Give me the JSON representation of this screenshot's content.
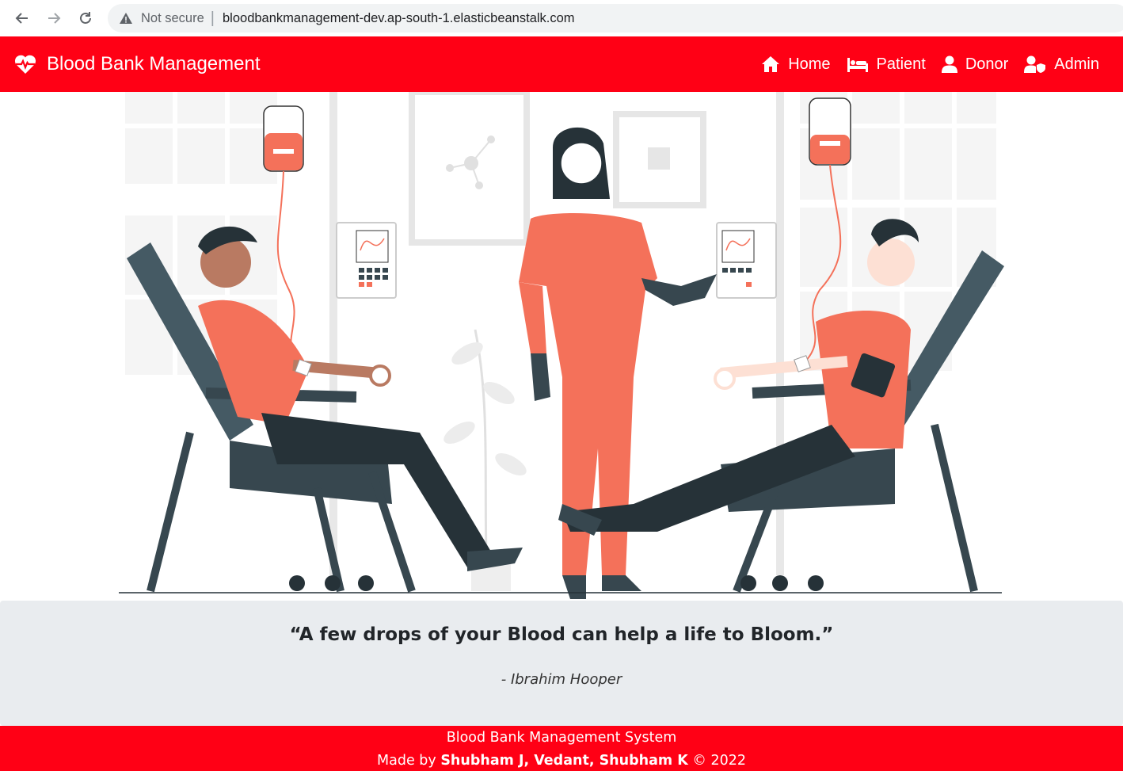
{
  "browser": {
    "security_label": "Not secure",
    "url": "bloodbankmanagement-dev.ap-south-1.elasticbeanstalk.com"
  },
  "navbar": {
    "brand": "Blood Bank Management",
    "items": [
      {
        "label": "Home",
        "icon": "home-icon"
      },
      {
        "label": "Patient",
        "icon": "bed-icon"
      },
      {
        "label": "Donor",
        "icon": "user-icon"
      },
      {
        "label": "Admin",
        "icon": "user-shield-icon"
      }
    ]
  },
  "hero": {
    "illustration": "blood-donation-illustration"
  },
  "quote": {
    "text": "“A few drops of your Blood can help a life to Bloom.”",
    "author": "- Ibrahim Hooper"
  },
  "footer": {
    "line1": "Blood Bank Management System",
    "made_by_prefix": "Made by",
    "authors": "Shubham J, Vedant, Shubham K",
    "copyright": "© 2022"
  },
  "colors": {
    "brand_red": "#ff0015",
    "quote_bg": "#e9ecef",
    "scrub_orange": "#f4715a",
    "chair_dark": "#37474f"
  }
}
